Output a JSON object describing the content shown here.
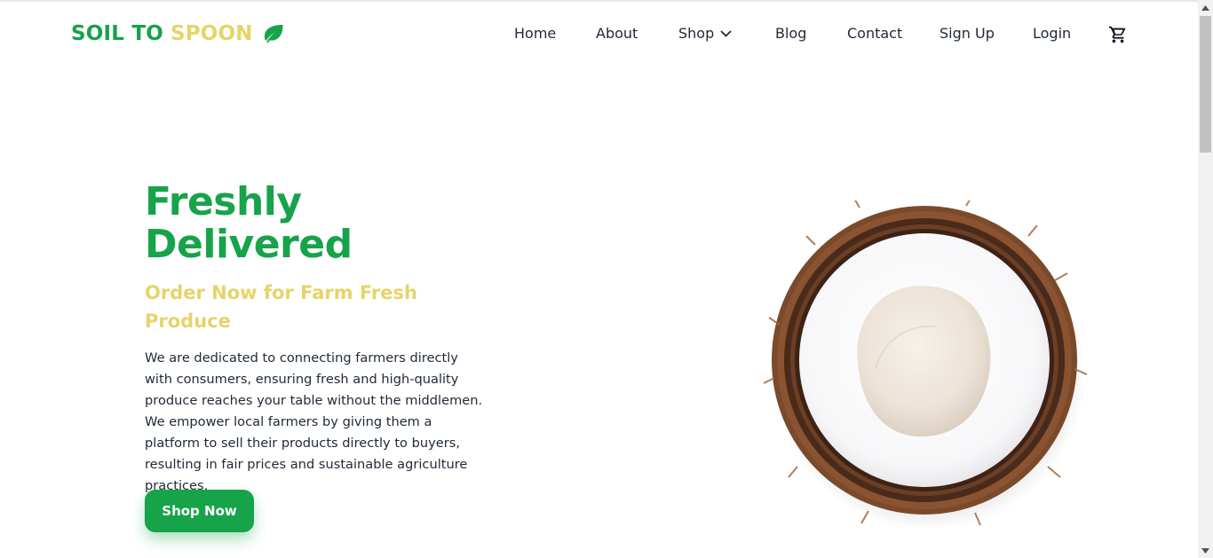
{
  "brand": {
    "part1": "SOIL TO",
    "part2": "SPOON",
    "icon": "leaf-icon",
    "green": "#16a34a",
    "yellow": "#e5d46a"
  },
  "nav": {
    "items": [
      {
        "label": "Home"
      },
      {
        "label": "About"
      },
      {
        "label": "Shop",
        "has_dropdown": true,
        "dropdown_icon": "chevron-down-icon"
      },
      {
        "label": "Blog"
      },
      {
        "label": "Contact"
      },
      {
        "label": "Sign Up"
      },
      {
        "label": "Login"
      }
    ],
    "cart_icon": "cart-icon"
  },
  "hero": {
    "title_line1": "Freshly",
    "title_line2": "Delivered",
    "subtitle": "Order Now for Farm Fresh Produce",
    "description": "We are dedicated to connecting farmers directly with consumers, ensuring fresh and high-quality produce reaches your table without the middlemen. We empower local farmers by giving them a platform to sell their products directly to buyers, resulting in fair prices and sustainable agriculture practices.",
    "cta_label": "Shop Now",
    "image": "coconut-half-image"
  }
}
